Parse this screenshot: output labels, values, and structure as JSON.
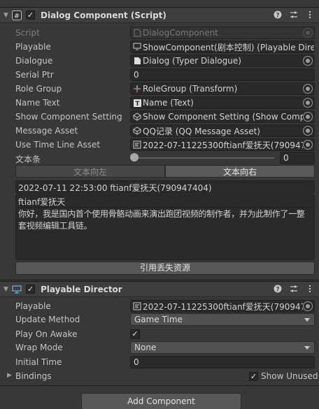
{
  "dialog_component": {
    "title": "Dialog Component (Script)",
    "enabled_check": "✓",
    "header_icons": [
      "help-icon",
      "presets-icon",
      "more-icon"
    ],
    "fields": {
      "script": {
        "label": "Script",
        "value": "DialogComponent"
      },
      "playable": {
        "label": "Playable",
        "value": "ShowComponent(剧本控制) (Playable Dire"
      },
      "dialogue": {
        "label": "Dialogue",
        "value": "Dialog (Typer Dialogue)"
      },
      "serial_ptr": {
        "label": "Serial Ptr",
        "value": "0"
      },
      "role_group": {
        "label": "Role Group",
        "value": "RoleGroup (Transform)"
      },
      "name_text": {
        "label": "Name Text",
        "value": "Name (Text)"
      },
      "show_component_setting": {
        "label": "Show Component Setting",
        "value": "Show Component Setting (Show Compon"
      },
      "message_asset": {
        "label": "Message Asset",
        "value": "QQ记录 (QQ Message Asset)"
      },
      "use_time_line_asset": {
        "label": "Use Time Line Asset",
        "value": "2022-07-11225300ftianf爱抚天(790947404"
      },
      "text_count": {
        "label": "文本条",
        "value": "0"
      }
    },
    "tabs": {
      "left": "文本向左",
      "right": "文本向右"
    },
    "message": {
      "header": "2022-07-11 22:53:00 ftianf爱抚天(790947404)",
      "sender": "ftianf爱抚天",
      "body": "你好，我是国内首个使用骨骼动画来演出跑团视频的制作者，并为此制作了一整套视频编辑工具链。"
    },
    "missing_button": "引用丢失资源"
  },
  "playable_director": {
    "title": "Playable Director",
    "enabled_check": "✓",
    "fields": {
      "playable": {
        "label": "Playable",
        "value": "2022-07-11225300ftianf爱抚天(790947404"
      },
      "update_method": {
        "label": "Update Method",
        "value": "Game Time"
      },
      "play_on_awake": {
        "label": "Play On Awake",
        "checked": "✓"
      },
      "wrap_mode": {
        "label": "Wrap Mode",
        "value": "None"
      },
      "initial_time": {
        "label": "Initial Time",
        "value": "0"
      }
    },
    "bindings": {
      "label": "Bindings",
      "show_unused_label": "Show Unused",
      "show_unused_checked": "✓"
    }
  },
  "add_component": "Add Component",
  "colors": {
    "background": "#383838",
    "field": "#2a2a2a",
    "header": "#3e3e3e",
    "button": "#585858"
  }
}
